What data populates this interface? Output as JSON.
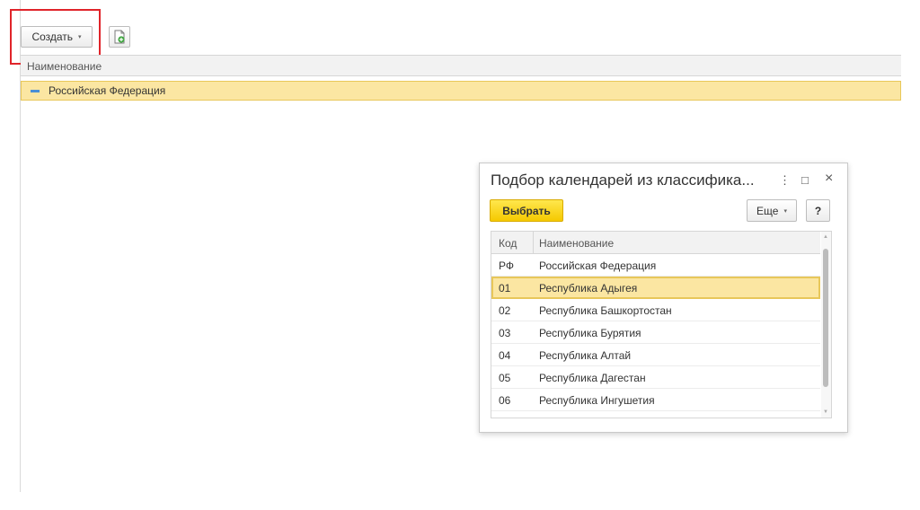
{
  "toolbar": {
    "create_label": "Создать",
    "create_caret": "▾"
  },
  "list": {
    "header": "Наименование",
    "rows": [
      {
        "label": "Российская Федерация",
        "icon": "minus-icon"
      }
    ]
  },
  "dialog": {
    "title": "Подбор календарей из классифика...",
    "select_label": "Выбрать",
    "more_label": "Еще",
    "more_caret": "▾",
    "help_label": "?",
    "controls": {
      "menu": "⋮",
      "maximize": "□",
      "close": "×"
    },
    "columns": {
      "code": "Код",
      "name": "Наименование"
    },
    "rows": [
      {
        "code": "РФ",
        "name": "Российская Федерация"
      },
      {
        "code": "01",
        "name": "Республика Адыгея"
      },
      {
        "code": "02",
        "name": "Республика Башкортостан"
      },
      {
        "code": "03",
        "name": "Республика Бурятия"
      },
      {
        "code": "04",
        "name": "Республика Алтай"
      },
      {
        "code": "05",
        "name": "Республика Дагестан"
      },
      {
        "code": "06",
        "name": "Республика Ингушетия"
      }
    ]
  },
  "colors": {
    "highlight_border": "#e0242a",
    "selected_row": "#fbe6a2",
    "primary_button": "#f5c900"
  }
}
